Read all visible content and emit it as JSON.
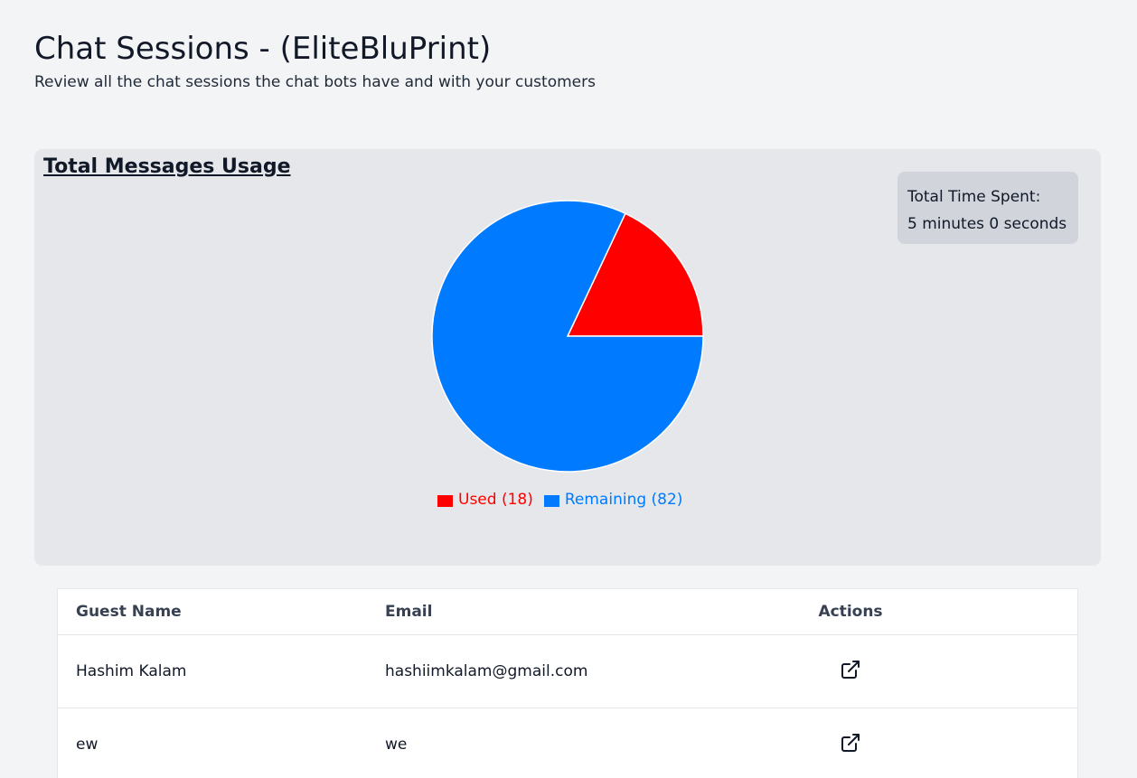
{
  "header": {
    "title": "Chat Sessions - (EliteBluPrint)",
    "subtitle": "Review all the chat sessions the chat bots have and with your customers"
  },
  "usage": {
    "title": "Total Messages Usage",
    "time_label": "Total Time Spent:",
    "time_value": "5 minutes 0 seconds"
  },
  "chart_data": {
    "type": "pie",
    "title": "Total Messages Usage",
    "categories": [
      "Used",
      "Remaining"
    ],
    "values": [
      18,
      82
    ],
    "colors": [
      "#ff0000",
      "#007bff"
    ],
    "legend_labels": [
      "Used (18)",
      "Remaining (82)"
    ],
    "legend_placement": "bottom"
  },
  "table": {
    "headers": {
      "name": "Guest Name",
      "email": "Email",
      "actions": "Actions"
    },
    "rows": [
      {
        "name": "Hashim Kalam",
        "email": "hashiimkalam@gmail.com",
        "action_icon": "external-link-icon"
      },
      {
        "name": "ew",
        "email": "we",
        "action_icon": "external-link-icon"
      }
    ]
  }
}
